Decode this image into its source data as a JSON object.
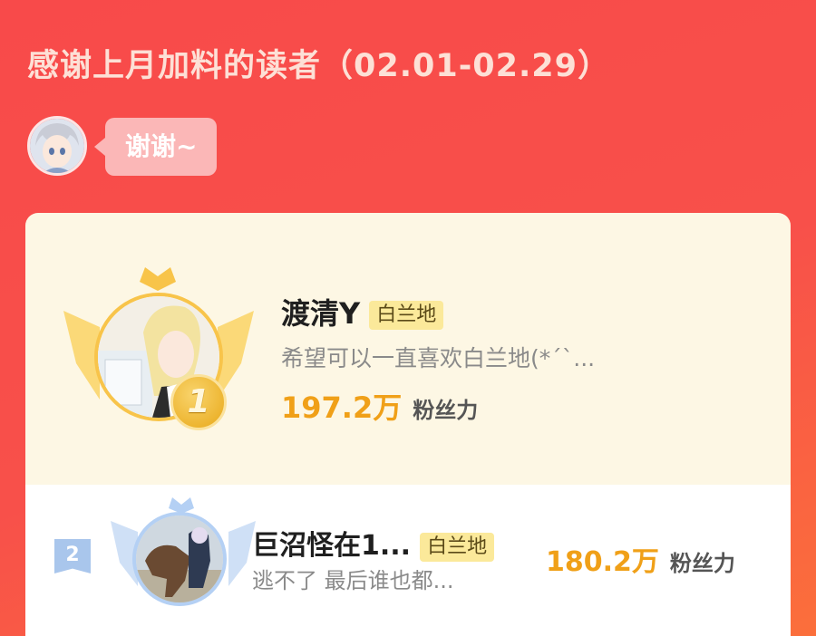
{
  "header": {
    "title": "感谢上月加料的读者（02.01-02.29）"
  },
  "host": {
    "bubble_text": "谢谢~"
  },
  "ranking": [
    {
      "rank": "1",
      "name": "渡清Y",
      "tag": "白兰地",
      "message": "希望可以一直喜欢白兰地(*´`...",
      "score": "197.2万",
      "unit": "粉丝力"
    },
    {
      "rank": "2",
      "name": "巨沼怪在1...",
      "tag": "白兰地",
      "message": "逃不了 最后谁也都...",
      "score": "180.2万",
      "unit": "粉丝力"
    }
  ],
  "colors": {
    "background_start": "#f84a4a",
    "background_end": "#fb6f3b",
    "card_bg": "#fdf7e4",
    "gold": "#f0a018",
    "silver_blue": "#a9c6ec"
  }
}
